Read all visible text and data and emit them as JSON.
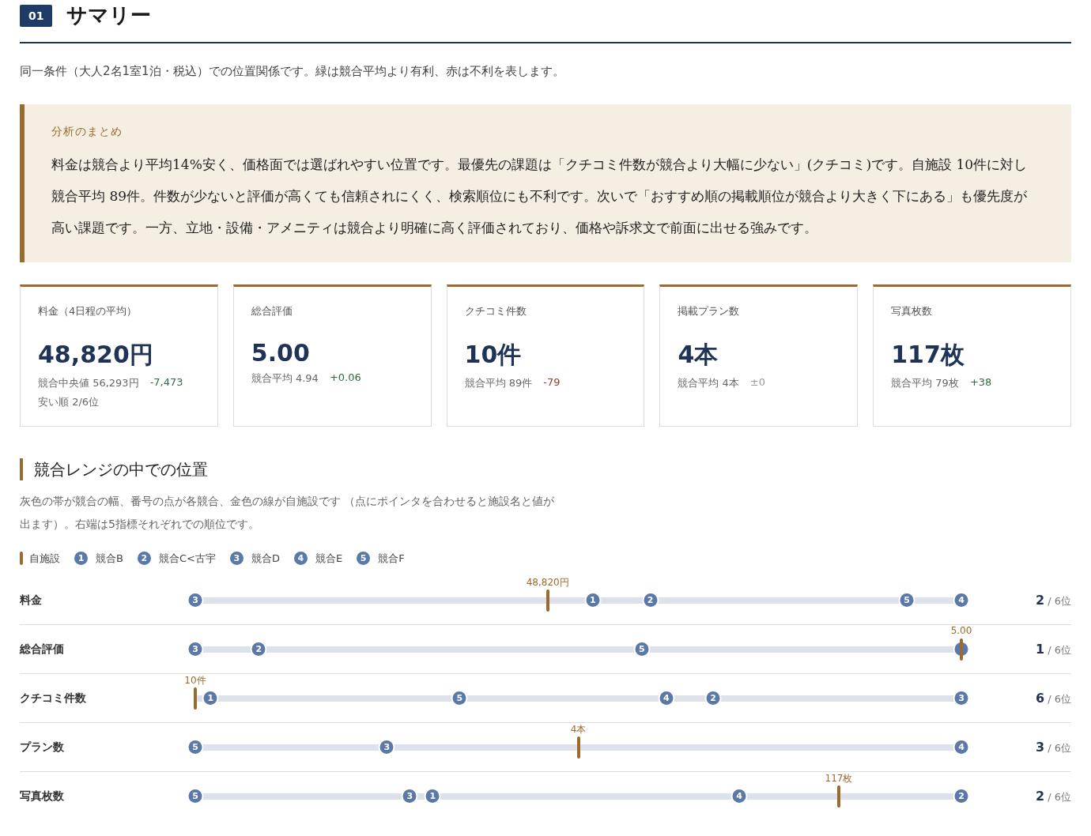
{
  "section": {
    "number": "01",
    "title": "サマリー",
    "note": "同一条件（大人2名1室1泊・税込）での位置関係です。緑は競合平均より有利、赤は不利を表します。"
  },
  "analysis": {
    "heading": "分析のまとめ",
    "body": "料金は競合より平均14%安く、価格面では選ばれやすい位置です。最優先の課題は「クチコミ件数が競合より大幅に少ない」(クチコミ)です。自施設 10件に対し競合平均 89件。件数が少ないと評価が高くても信頼されにくく、検索順位にも不利です。次いで「おすすめ順の掲載順位が競合より大きく下にある」も優先度が高い課題です。一方、立地・設備・アメニティは競合より明確に高く評価されており、価格や訴求文で前面に出せる強みです。"
  },
  "cards": [
    {
      "label": "料金（4日程の平均）",
      "value": "48,820円",
      "compare": "競合中央値 56,293円",
      "delta": "-7,473",
      "color": "#2e6b3f",
      "extra": "安い順 2/6位"
    },
    {
      "label": "総合評価",
      "value": "5.00",
      "compare": "競合平均 4.94",
      "delta": "+0.06",
      "color": "#2e6b3f"
    },
    {
      "label": "クチコミ件数",
      "value": "10件",
      "compare": "競合平均 89件",
      "delta": "-79",
      "color": "#a3382a"
    },
    {
      "label": "掲載プラン数",
      "value": "4本",
      "compare": "競合平均 4本",
      "delta": "±0",
      "color": "#999999"
    },
    {
      "label": "写真枚数",
      "value": "117枚",
      "compare": "競合平均 79枚",
      "delta": "+38",
      "color": "#2e6b3f"
    }
  ],
  "range": {
    "title": "競合レンジの中での位置",
    "description": "灰色の帯が競合の幅、番号の点が各競合、金色の線が自施設です （点にポインタを合わせると施設名と値が出ます）。右端は5指標それぞれでの順位です。",
    "legend": [
      {
        "kind": "self",
        "label": "自施設"
      },
      {
        "kind": "competitor",
        "number": "1",
        "label": "競合B"
      },
      {
        "kind": "competitor",
        "number": "2",
        "label": "競合C<古宇"
      },
      {
        "kind": "competitor",
        "number": "3",
        "label": "競合D"
      },
      {
        "kind": "competitor",
        "number": "4",
        "label": "競合E"
      },
      {
        "kind": "competitor",
        "number": "5",
        "label": "競合F"
      }
    ],
    "rows": [
      {
        "label": "料金",
        "self_label": "48,820円",
        "self": {
          "level": 0.46
        },
        "dots": [
          {
            "number": "3",
            "level": 0
          },
          {
            "number": "1",
            "level": 0.519
          },
          {
            "number": "2",
            "level": 0.594
          },
          {
            "number": "5",
            "level": 0.929
          },
          {
            "number": "4",
            "level": 1
          }
        ],
        "rank": "2",
        "rank_total": "/ 6位"
      },
      {
        "label": "総合評価",
        "self_label": "5.00",
        "self": {
          "level": 1
        },
        "dots": [
          {
            "number": "3",
            "level": 0
          },
          {
            "number": "2",
            "level": 0.083
          },
          {
            "number": "5",
            "level": 0.583
          },
          {
            "level": 1
          }
        ],
        "rank": "1",
        "rank_total": "/ 6位"
      },
      {
        "label": "クチコミ件数",
        "self_label": "10件",
        "self": {
          "level": 0
        },
        "dots": [
          {
            "number": "1",
            "level": 0.02
          },
          {
            "number": "5",
            "level": 0.345
          },
          {
            "number": "4",
            "level": 0.615
          },
          {
            "number": "2",
            "level": 0.676
          },
          {
            "number": "3",
            "level": 1
          }
        ],
        "rank": "6",
        "rank_total": "/ 6位"
      },
      {
        "label": "プラン数",
        "self_label": "4本",
        "self": {
          "level": 0.5
        },
        "dots": [
          {
            "number": "5",
            "level": 0
          },
          {
            "number": "3",
            "level": 0.25
          },
          {
            "number": "4",
            "level": 1
          }
        ],
        "rank": "3",
        "rank_total": "/ 6位"
      },
      {
        "label": "写真枚数",
        "self_label": "117枚",
        "self": {
          "level": 0.84
        },
        "dots": [
          {
            "number": "5",
            "level": 0
          },
          {
            "number": "3",
            "level": 0.28
          },
          {
            "number": "1",
            "level": 0.31
          },
          {
            "number": "4",
            "level": 0.71
          },
          {
            "number": "2",
            "level": 1
          }
        ],
        "rank": "2",
        "rank_total": "/ 6位"
      }
    ]
  }
}
